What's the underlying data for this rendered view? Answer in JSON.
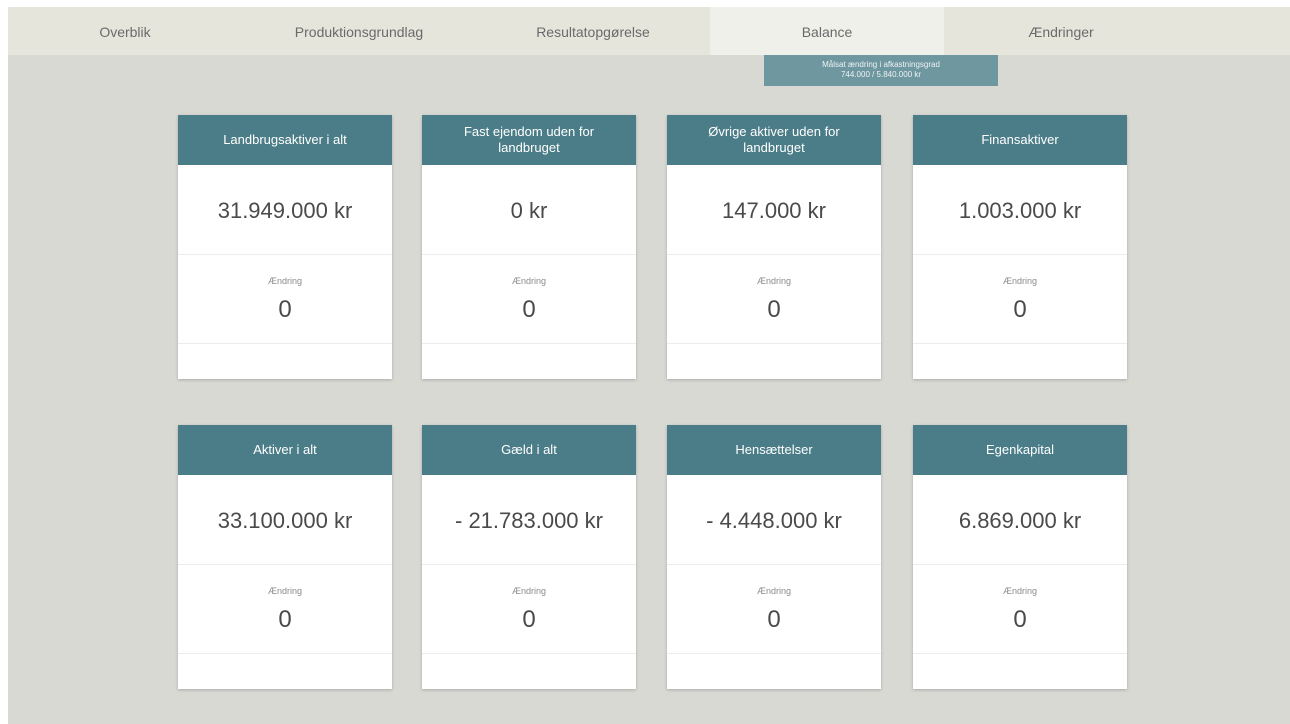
{
  "tabs": [
    {
      "label": "Overblik"
    },
    {
      "label": "Produktionsgrundlag"
    },
    {
      "label": "Resultatopgørelse"
    },
    {
      "label": "Balance"
    },
    {
      "label": "Ændringer"
    }
  ],
  "active_tab": "Balance",
  "banner": {
    "line1": "Målsat ændring i afkastningsgrad",
    "line2": "744.000 / 5.840.000 kr"
  },
  "cards": [
    {
      "title": "Landbrugsaktiver i alt",
      "value": "31.949.000 kr",
      "change_label": "Ændring",
      "change_value": "0"
    },
    {
      "title": "Fast ejendom uden for landbruget",
      "value": "0 kr",
      "change_label": "Ændring",
      "change_value": "0"
    },
    {
      "title": "Øvrige aktiver uden for landbruget",
      "value": "147.000 kr",
      "change_label": "Ændring",
      "change_value": "0"
    },
    {
      "title": "Finansaktiver",
      "value": "1.003.000 kr",
      "change_label": "Ændring",
      "change_value": "0"
    },
    {
      "title": "Aktiver i alt",
      "value": "33.100.000 kr",
      "change_label": "Ændring",
      "change_value": "0"
    },
    {
      "title": "Gæld i alt",
      "value": "- 21.783.000 kr",
      "change_label": "Ændring",
      "change_value": "0"
    },
    {
      "title": "Hensættelser",
      "value": "- 4.448.000 kr",
      "change_label": "Ændring",
      "change_value": "0"
    },
    {
      "title": "Egenkapital",
      "value": "6.869.000 kr",
      "change_label": "Ændring",
      "change_value": "0"
    }
  ],
  "colors": {
    "header": "#4b7d88",
    "banner": "#6f97a0",
    "background": "#d9d9d4",
    "tabbar": "#e6e5dc"
  }
}
